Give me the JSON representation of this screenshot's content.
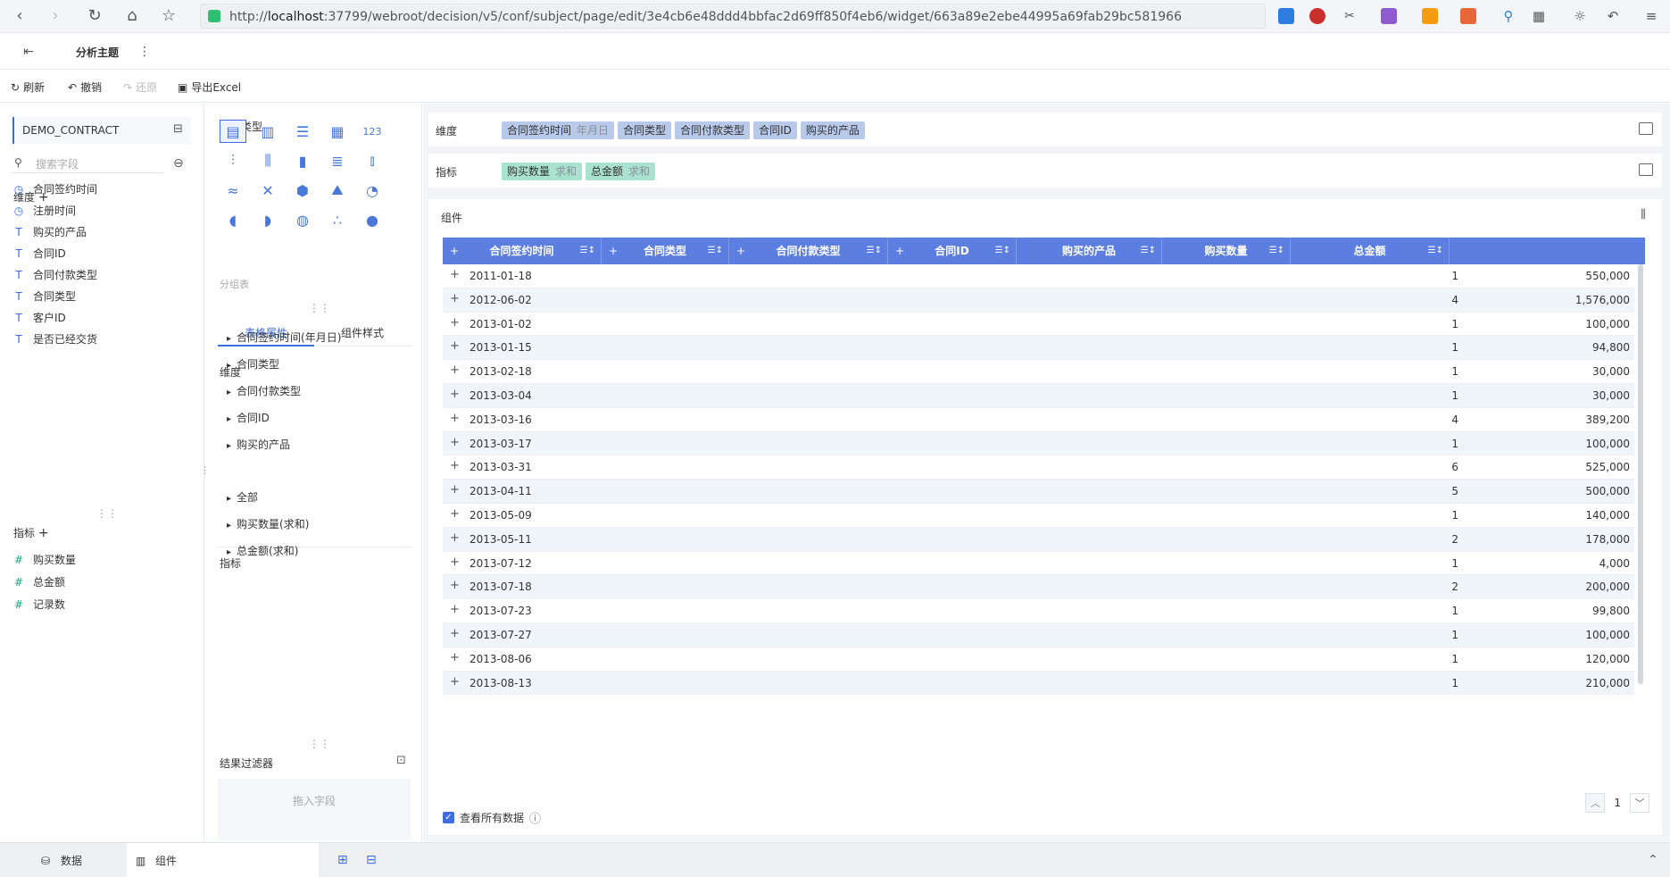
{
  "browser": {
    "url_prefix": "http://",
    "url_host": "localhost",
    "url_rest": ":37799/webroot/decision/v5/conf/subject/page/edit/3e4cb6e48ddd4bbfac2d69ff850f4eb6/widget/663a89e2ebe44995a69fab29bc581966"
  },
  "header": {
    "title": "分析主题"
  },
  "toolbar": {
    "refresh": "刷新",
    "undo": "撤销",
    "redo": "还原",
    "export": "导出Excel"
  },
  "left_panel": {
    "dataset": "DEMO_CONTRACT",
    "search_placeholder": "搜索字段",
    "dimension_title": "维度",
    "dimensions": [
      {
        "label": "合同签约时间",
        "icon": "clock-icon"
      },
      {
        "label": "注册时间",
        "icon": "clock-icon"
      },
      {
        "label": "购买的产品",
        "icon": "text-icon"
      },
      {
        "label": "合同ID",
        "icon": "text-icon"
      },
      {
        "label": "合同付款类型",
        "icon": "text-icon"
      },
      {
        "label": "合同类型",
        "icon": "text-icon"
      },
      {
        "label": "客户ID",
        "icon": "text-icon"
      },
      {
        "label": "是否已经交货",
        "icon": "text-icon"
      }
    ],
    "measure_title": "指标",
    "measures": [
      {
        "label": "购买数量"
      },
      {
        "label": "总金额"
      },
      {
        "label": "记录数"
      }
    ]
  },
  "mid_panel": {
    "chart_type_title": "图表类型",
    "chart_type_hint": "分组表",
    "tabs": [
      "表格属性",
      "组件样式"
    ],
    "dimension_title": "维度",
    "dimension_items": [
      "合同签约时间(年月日)",
      "合同类型",
      "合同付款类型",
      "合同ID",
      "购买的产品"
    ],
    "measure_title": "指标",
    "measure_items": [
      "全部",
      "购买数量(求和)",
      "总金额(求和)"
    ],
    "filter_title": "结果过滤器",
    "filter_drop": "拖入字段"
  },
  "shelves": {
    "dimension_label": "维度",
    "dimension_pills": [
      {
        "label": "合同签约时间",
        "suffix": "年月日"
      },
      {
        "label": "合同类型",
        "suffix": ""
      },
      {
        "label": "合同付款类型",
        "suffix": ""
      },
      {
        "label": "合同ID",
        "suffix": ""
      },
      {
        "label": "购买的产品",
        "suffix": ""
      }
    ],
    "measure_label": "指标",
    "measure_pills": [
      {
        "label": "购买数量",
        "suffix": "求和"
      },
      {
        "label": "总金额",
        "suffix": "求和"
      }
    ]
  },
  "widget": {
    "title": "组件",
    "columns": [
      "合同签约时间",
      "合同类型",
      "合同付款类型",
      "合同ID",
      "购买的产品",
      "购买数量",
      "总金额"
    ],
    "rows": [
      {
        "date": "2011-01-18",
        "qty": "1",
        "amt": "550,000"
      },
      {
        "date": "2012-06-02",
        "qty": "4",
        "amt": "1,576,000"
      },
      {
        "date": "2013-01-02",
        "qty": "1",
        "amt": "100,000"
      },
      {
        "date": "2013-01-15",
        "qty": "1",
        "amt": "94,800"
      },
      {
        "date": "2013-02-18",
        "qty": "1",
        "amt": "30,000"
      },
      {
        "date": "2013-03-04",
        "qty": "1",
        "amt": "30,000"
      },
      {
        "date": "2013-03-16",
        "qty": "4",
        "amt": "389,200"
      },
      {
        "date": "2013-03-17",
        "qty": "1",
        "amt": "100,000"
      },
      {
        "date": "2013-03-31",
        "qty": "6",
        "amt": "525,000"
      },
      {
        "date": "2013-04-11",
        "qty": "5",
        "amt": "500,000"
      },
      {
        "date": "2013-05-09",
        "qty": "1",
        "amt": "140,000"
      },
      {
        "date": "2013-05-11",
        "qty": "2",
        "amt": "178,000"
      },
      {
        "date": "2013-07-12",
        "qty": "1",
        "amt": "4,000"
      },
      {
        "date": "2013-07-18",
        "qty": "2",
        "amt": "200,000"
      },
      {
        "date": "2013-07-23",
        "qty": "1",
        "amt": "99,800"
      },
      {
        "date": "2013-07-27",
        "qty": "1",
        "amt": "100,000"
      },
      {
        "date": "2013-08-06",
        "qty": "1",
        "amt": "120,000"
      },
      {
        "date": "2013-08-13",
        "qty": "1",
        "amt": "210,000"
      }
    ],
    "page": "1",
    "view_all": "查看所有数据"
  },
  "bottom_bar": {
    "data_tab": "数据",
    "widget_tab": "组件"
  },
  "colors": {
    "accent": "#3d6de0",
    "table_header": "#5b7ee0",
    "dimension_pill": "#b9c9ea",
    "measure_pill": "#a9e2cf"
  }
}
